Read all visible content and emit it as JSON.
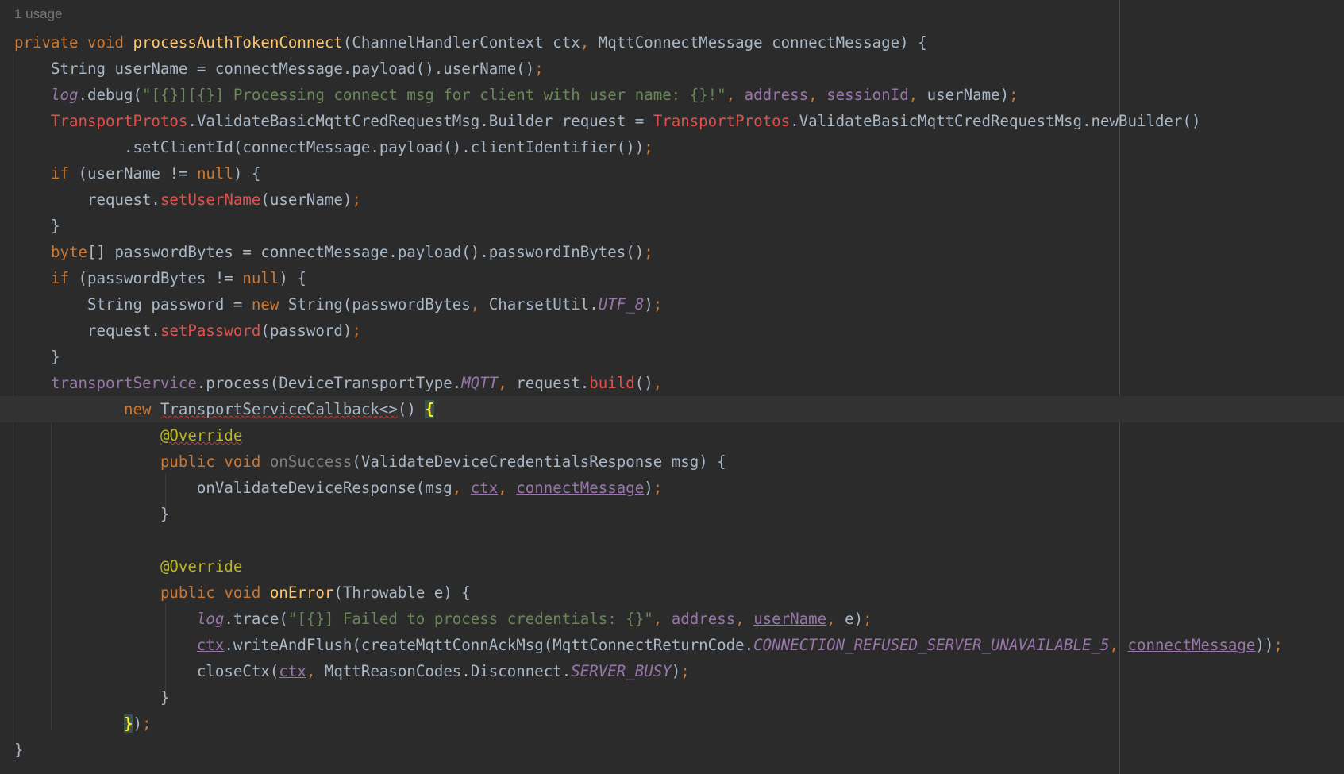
{
  "editor": {
    "usage_hint": "1 usage",
    "colors": {
      "background": "#2b2b2b",
      "keyword": "#cc7832",
      "method_declaration": "#ffc66d",
      "string": "#6a8759",
      "field": "#9876aa",
      "annotation": "#bbb529",
      "plain": "#a9b7c6"
    },
    "lines": [
      [
        [
          "kw",
          "private void "
        ],
        [
          "fn",
          "processAuthTokenConnect"
        ],
        [
          "",
          "(ChannelHandlerContext ctx"
        ],
        [
          "punc",
          ", "
        ],
        [
          "",
          "MqttConnectMessage connectMessage) {"
        ]
      ],
      [
        [
          "",
          "    String userName = connectMessage.payload().userName()"
        ],
        [
          "punc",
          ";"
        ]
      ],
      [
        [
          "",
          "    "
        ],
        [
          "sfld",
          "log"
        ],
        [
          "",
          ".debug("
        ],
        [
          "str",
          "\"[{}][{}] Processing connect msg for client with user name: {}!\""
        ],
        [
          "punc",
          ", "
        ],
        [
          "fld",
          "address"
        ],
        [
          "punc",
          ", "
        ],
        [
          "fld",
          "sessionId"
        ],
        [
          "punc",
          ", "
        ],
        [
          "",
          "userName)"
        ],
        [
          "punc",
          ";"
        ]
      ],
      [
        [
          "",
          "    "
        ],
        [
          "call",
          "TransportProtos"
        ],
        [
          "",
          ".ValidateBasicMqttCredRequestMsg.Builder request = "
        ],
        [
          "call",
          "TransportProtos"
        ],
        [
          "",
          ".ValidateBasicMqttCredRequestMsg.newBuilder()"
        ]
      ],
      [
        [
          "",
          "            .setClientId(connectMessage.payload().clientIdentifier())"
        ],
        [
          "punc",
          ";"
        ]
      ],
      [
        [
          "",
          "    "
        ],
        [
          "kw",
          "if "
        ],
        [
          "",
          "(userName != "
        ],
        [
          "kw",
          "null"
        ],
        [
          "",
          ") {"
        ]
      ],
      [
        [
          "",
          "        request."
        ],
        [
          "call",
          "setUserName"
        ],
        [
          "",
          "(userName)"
        ],
        [
          "punc",
          ";"
        ]
      ],
      [
        [
          "",
          "    }"
        ]
      ],
      [
        [
          "",
          "    "
        ],
        [
          "kw",
          "byte"
        ],
        [
          "",
          "[] passwordBytes = connectMessage.payload().passwordInBytes()"
        ],
        [
          "punc",
          ";"
        ]
      ],
      [
        [
          "",
          "    "
        ],
        [
          "kw",
          "if "
        ],
        [
          "",
          "(passwordBytes != "
        ],
        [
          "kw",
          "null"
        ],
        [
          "",
          ") {"
        ]
      ],
      [
        [
          "",
          "        String password = "
        ],
        [
          "kw",
          "new "
        ],
        [
          "",
          "String(passwordBytes"
        ],
        [
          "punc",
          ", "
        ],
        [
          "",
          "CharsetUtil."
        ],
        [
          "sfld",
          "UTF_8"
        ],
        [
          "",
          ")"
        ],
        [
          "punc",
          ";"
        ]
      ],
      [
        [
          "",
          "        request."
        ],
        [
          "call",
          "setPassword"
        ],
        [
          "",
          "(password)"
        ],
        [
          "punc",
          ";"
        ]
      ],
      [
        [
          "",
          "    }"
        ]
      ],
      [
        [
          "",
          "    "
        ],
        [
          "fld",
          "transportService"
        ],
        [
          "",
          ".process(DeviceTransportType."
        ],
        [
          "sfld",
          "MQTT"
        ],
        [
          "punc",
          ", "
        ],
        [
          "",
          "request."
        ],
        [
          "call",
          "build"
        ],
        [
          "",
          "()"
        ],
        [
          "punc",
          ","
        ]
      ],
      [
        [
          "",
          "            "
        ],
        [
          "kw",
          "new "
        ],
        [
          "wavy",
          "TransportServiceCallback<>"
        ],
        [
          "",
          "() "
        ],
        [
          "brace-hl",
          "{"
        ]
      ],
      [
        [
          "",
          "                "
        ],
        [
          "ann wavy",
          "@Override"
        ]
      ],
      [
        [
          "",
          "                "
        ],
        [
          "kw",
          "public void "
        ],
        [
          "gray",
          "onSuccess"
        ],
        [
          "",
          "(ValidateDeviceCredentialsResponse msg) {"
        ]
      ],
      [
        [
          "",
          "                    onValidateDeviceResponse(msg"
        ],
        [
          "punc",
          ", "
        ],
        [
          "fld ul",
          "ctx"
        ],
        [
          "punc",
          ", "
        ],
        [
          "fld ul",
          "connectMessage"
        ],
        [
          "",
          ")"
        ],
        [
          "punc",
          ";"
        ]
      ],
      [
        [
          "",
          "                }"
        ]
      ],
      [
        [
          "",
          ""
        ]
      ],
      [
        [
          "",
          "                "
        ],
        [
          "ann",
          "@Override"
        ]
      ],
      [
        [
          "",
          "                "
        ],
        [
          "kw",
          "public void "
        ],
        [
          "fn",
          "onError"
        ],
        [
          "",
          "(Throwable e) {"
        ]
      ],
      [
        [
          "",
          "                    "
        ],
        [
          "sfld",
          "log"
        ],
        [
          "",
          ".trace("
        ],
        [
          "str",
          "\"[{}] Failed to process credentials: {}\""
        ],
        [
          "punc",
          ", "
        ],
        [
          "fld",
          "address"
        ],
        [
          "punc",
          ", "
        ],
        [
          "fld ul",
          "userName"
        ],
        [
          "punc",
          ", "
        ],
        [
          "",
          "e)"
        ],
        [
          "punc",
          ";"
        ]
      ],
      [
        [
          "",
          "                    "
        ],
        [
          "fld ul",
          "ctx"
        ],
        [
          "",
          ".writeAndFlush(createMqttConnAckMsg(MqttConnectReturnCode."
        ],
        [
          "sfld",
          "CONNECTION_REFUSED_SERVER_UNAVAILABLE_5"
        ],
        [
          "punc",
          ", "
        ],
        [
          "fld ul",
          "connectMessage"
        ],
        [
          "",
          "))"
        ],
        [
          "punc",
          ";"
        ]
      ],
      [
        [
          "",
          "                    closeCtx("
        ],
        [
          "fld ul",
          "ctx"
        ],
        [
          "punc",
          ", "
        ],
        [
          "",
          "MqttReasonCodes.Disconnect."
        ],
        [
          "sfld",
          "SERVER_BUSY"
        ],
        [
          "",
          ")"
        ],
        [
          "punc",
          ";"
        ]
      ],
      [
        [
          "",
          "                }"
        ]
      ],
      [
        [
          "",
          "            "
        ],
        [
          "brace-hl",
          "}"
        ],
        [
          "",
          ")"
        ],
        [
          "punc",
          ";"
        ]
      ],
      [
        [
          "",
          "}"
        ]
      ]
    ],
    "current_line_index": 14
  }
}
